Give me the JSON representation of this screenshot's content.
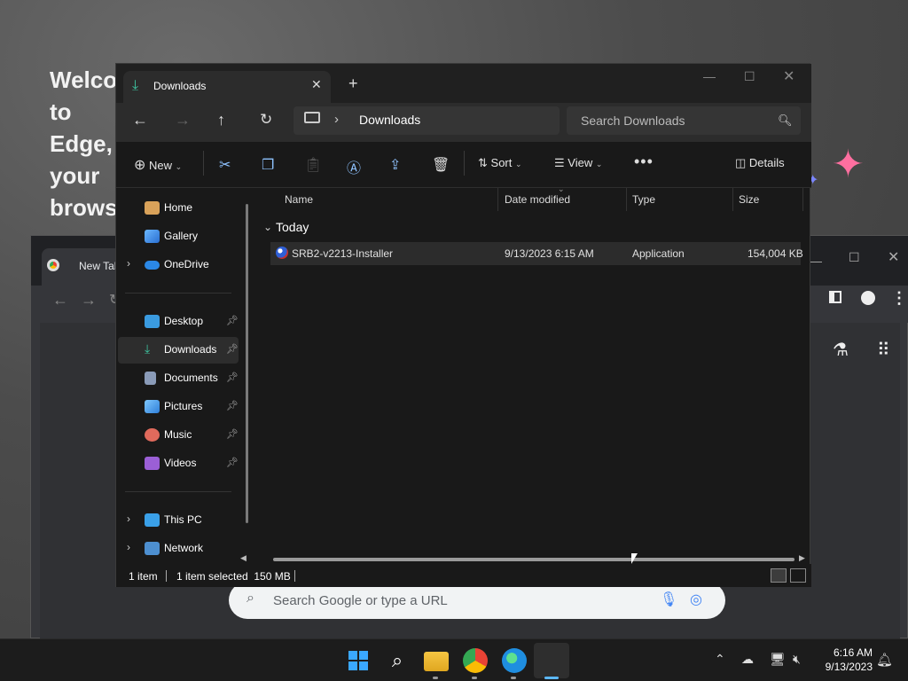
{
  "background": {
    "welcome_text": "Welcome to\nEdge, your\nbrowser"
  },
  "chrome": {
    "tab_title": "New Tab",
    "search_placeholder": "Search Google or type a URL"
  },
  "explorer": {
    "tab_title": "Downloads",
    "address_location": "Downloads",
    "search_placeholder": "Search Downloads",
    "commands": {
      "new_label": "New",
      "sort_label": "Sort",
      "view_label": "View",
      "details_label": "Details"
    },
    "sidebar": {
      "items": [
        {
          "label": "Home",
          "icon": "home-icon"
        },
        {
          "label": "Gallery",
          "icon": "gallery-icon"
        },
        {
          "label": "OneDrive",
          "icon": "onedrive-icon"
        },
        {
          "label": "Desktop",
          "icon": "desktop-icon"
        },
        {
          "label": "Downloads",
          "icon": "downloads-icon"
        },
        {
          "label": "Documents",
          "icon": "documents-icon"
        },
        {
          "label": "Pictures",
          "icon": "pictures-icon"
        },
        {
          "label": "Music",
          "icon": "music-icon"
        },
        {
          "label": "Videos",
          "icon": "videos-icon"
        },
        {
          "label": "This PC",
          "icon": "this-pc-icon"
        },
        {
          "label": "Network",
          "icon": "network-icon"
        }
      ]
    },
    "columns": [
      "Name",
      "Date modified",
      "Type",
      "Size"
    ],
    "group_label": "Today",
    "files": [
      {
        "name": "SRB2-v2213-Installer",
        "date": "9/13/2023 6:15 AM",
        "type": "Application",
        "size": "154,004 KB"
      }
    ],
    "status": {
      "item_count": "1 item",
      "selected": "1 item selected  150 MB"
    }
  },
  "taskbar": {
    "time": "6:16 AM",
    "date": "9/13/2023"
  },
  "colors": {
    "accent": "#5cb8ff",
    "downloads_green": "#3ec4a0",
    "sparkle_pink": "#ff6fa0"
  }
}
